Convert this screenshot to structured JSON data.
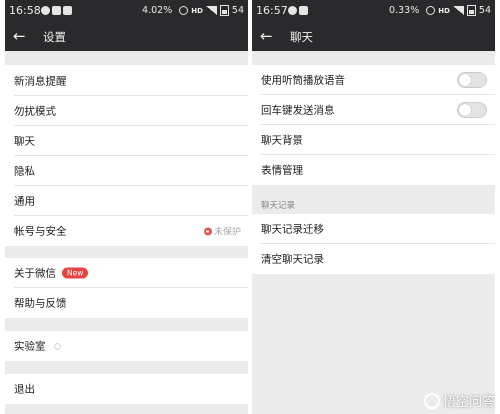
{
  "left_screen": {
    "status": {
      "time": "16:58",
      "percent": "4.02%",
      "battery": "54"
    },
    "title": "设置",
    "items": [
      {
        "label": "新消息提醒"
      },
      {
        "label": "勿扰模式"
      },
      {
        "label": "聊天"
      },
      {
        "label": "隐私"
      },
      {
        "label": "通用"
      },
      {
        "label": "帐号与安全",
        "status": "未保护"
      },
      {
        "label": "关于微信",
        "badge": "New"
      },
      {
        "label": "帮助与反馈"
      },
      {
        "label": "实验室"
      },
      {
        "label": "退出"
      }
    ]
  },
  "right_screen": {
    "status": {
      "time": "16:57",
      "percent": "0.33%",
      "battery": "54"
    },
    "title": "聊天",
    "toggles": [
      {
        "label": "使用听筒播放语音",
        "on": false
      },
      {
        "label": "回车键发送消息",
        "on": false
      }
    ],
    "items": [
      {
        "label": "聊天背景"
      },
      {
        "label": "表情管理"
      }
    ],
    "section_title": "聊天记录",
    "history_items": [
      {
        "label": "聊天记录迁移"
      },
      {
        "label": "清空聊天记录"
      }
    ]
  },
  "watermark": "悟空问答",
  "icons": {
    "back": "arrow-left-icon",
    "lock": "lock-icon",
    "pin": "location-pin-icon",
    "toggle": "toggle-switch"
  },
  "colors": {
    "bar_bg": "#2a2a2c",
    "page_bg": "#ebebeb",
    "badge_red": "#e64340",
    "toggle_off": "#e3e3e3"
  }
}
